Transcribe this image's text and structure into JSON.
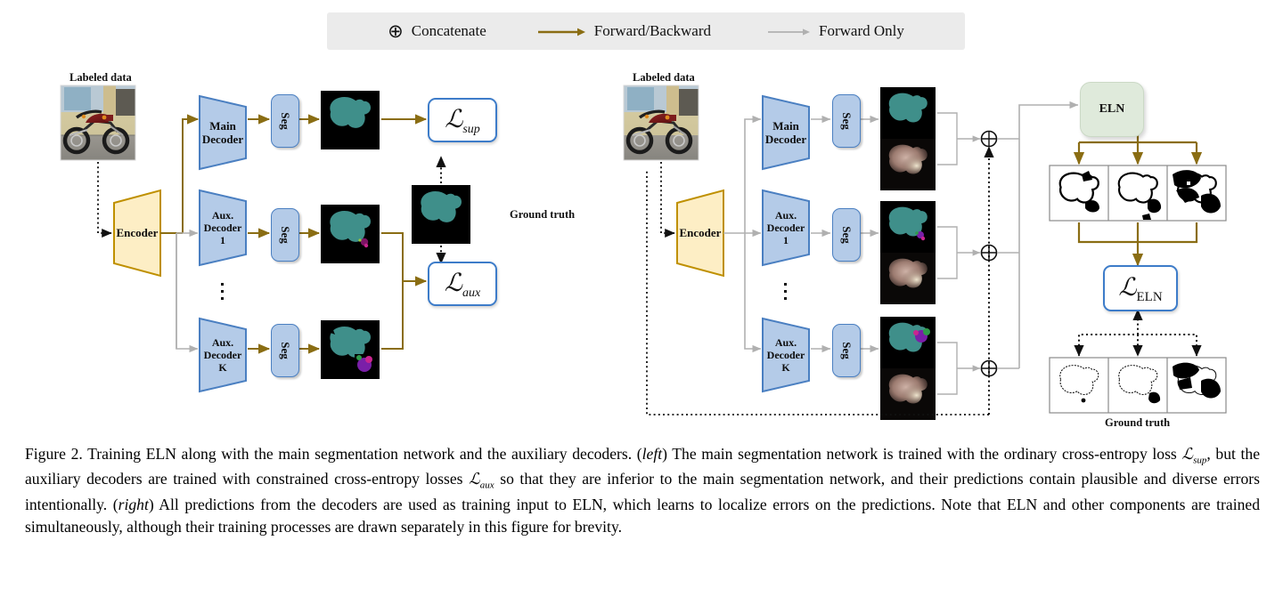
{
  "figure": {
    "number": "Figure 2.",
    "caption": "Training ELN along with the main segmentation network and the auxiliary decoders. (left) The main segmentation network is trained with the ordinary cross-entropy loss ℒsup, but the auxiliary decoders are trained with constrained cross-entropy losses ℒaux so that they are inferior to the main segmentation network, and their predictions contain plausible and diverse errors intentionally. (right) All predictions from the decoders are used as training input to ELN, which learns to localize errors on the predictions. Note that ELN and other components are trained simultaneously, although their training processes are drawn separately in this figure for brevity.",
    "caption_parts": {
      "p1": "Training ELN along with the main segmentation network and the auxiliary decoders. (",
      "left_em": "left",
      "p2": ") The main segmentation network is trained with the ordinary cross-entropy loss ",
      "loss_sup": "ℒ",
      "loss_sup_sub": "sup",
      "p3": ", but the auxiliary decoders are trained with constrained cross-entropy losses ",
      "loss_aux": "ℒ",
      "loss_aux_sub": "aux",
      "p4": " so that they are inferior to the main segmentation network, and their predictions contain plausible and diverse errors intentionally. (",
      "right_em": "right",
      "p5": ") All predictions from the decoders are used as training input to ELN, which learns to localize errors on the predictions. Note that ELN and other components are trained simultaneously, although their training processes are drawn separately in this figure for brevity."
    }
  },
  "legend": {
    "items": [
      {
        "icon": "oplus-icon",
        "glyph": "⊕",
        "label": "Concatenate"
      },
      {
        "icon": "forward-backward-arrow-icon",
        "glyph": "⟶",
        "label": "Forward/Backward",
        "color": "#8a6d13"
      },
      {
        "icon": "forward-only-arrow-icon",
        "glyph": "⟶",
        "label": "Forward Only",
        "color": "#b0b0b0"
      }
    ],
    "background": "#ebebeb"
  },
  "colors": {
    "decoder_fill": "#b4cbe8",
    "decoder_stroke": "#4a7fc1",
    "encoder_fill": "#fdeec5",
    "encoder_stroke": "#bf9000",
    "loss_stroke": "#3d7cc9",
    "eln_fill": "#dfeadb",
    "forward_backward": "#8a6d13",
    "forward_only": "#b0b0b0",
    "mask_teal": "#3f8f8a",
    "mask_background": "#000000"
  },
  "left_panel": {
    "name": "left-training-diagram",
    "input_label": "Labeled data",
    "input_image_alt": "motorcycle-photo",
    "encoder": {
      "label": "Encoder"
    },
    "decoders": [
      {
        "id": "main",
        "label_line1": "Main",
        "label_line2": "Decoder",
        "label_line3": "",
        "seg_label": "Seg",
        "mask": "clean-teal-mask"
      },
      {
        "id": "aux1",
        "label_line1": "Aux.",
        "label_line2": "Decoder",
        "label_line3": "1",
        "seg_label": "Seg",
        "mask": "teal-mask-small-error"
      },
      {
        "id": "auxK",
        "label_line1": "Aux.",
        "label_line2": "Decoder",
        "label_line3": "K",
        "seg_label": "Seg",
        "mask": "teal-mask-large-error"
      }
    ],
    "ellipsis": "⋮",
    "ground_truth_label": "Ground truth",
    "losses": [
      {
        "id": "sup",
        "symbol": "ℒ",
        "subscript": "sup"
      },
      {
        "id": "aux",
        "symbol": "ℒ",
        "subscript": "aux"
      }
    ]
  },
  "right_panel": {
    "name": "right-eln-diagram",
    "input_label": "Labeled data",
    "input_image_alt": "motorcycle-photo",
    "encoder": {
      "label": "Encoder"
    },
    "decoders": [
      {
        "id": "main",
        "label_line1": "Main",
        "label_line2": "Decoder",
        "label_line3": "",
        "seg_label": "Seg",
        "mask": "clean-teal-mask",
        "heatmap": "uncertainty-heatmap"
      },
      {
        "id": "aux1",
        "label_line1": "Aux.",
        "label_line2": "Decoder",
        "label_line3": "1",
        "seg_label": "Seg",
        "mask": "teal-mask-small-error",
        "heatmap": "uncertainty-heatmap"
      },
      {
        "id": "auxK",
        "label_line1": "Aux.",
        "label_line2": "Decoder",
        "label_line3": "K",
        "seg_label": "Seg",
        "mask": "teal-mask-large-error",
        "heatmap": "uncertainty-heatmap"
      }
    ],
    "ellipsis": "⋮",
    "concat_glyph": "⊕",
    "concat_count": 3,
    "eln": {
      "label": "ELN"
    },
    "prediction_panels": {
      "count": 3,
      "alt": "eln-error-prediction-maps"
    },
    "ground_truth_panels": {
      "count": 3,
      "label": "Ground truth",
      "alt": "ground-truth-error-maps"
    },
    "loss": {
      "id": "eln",
      "symbol": "ℒ",
      "subscript": "ELN"
    }
  }
}
